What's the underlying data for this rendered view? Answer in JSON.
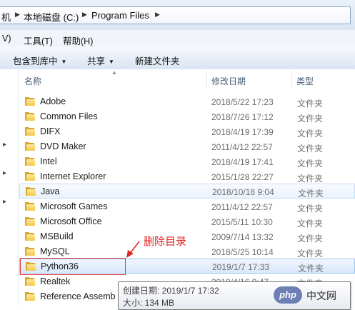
{
  "breadcrumb": {
    "partial": "机",
    "drive": "本地磁盘 (C:)",
    "folder": "Program Files"
  },
  "menu": {
    "view_partial": "V)",
    "tools": "工具(T)",
    "help": "帮助(H)"
  },
  "commands": {
    "include": "包含到库中",
    "share": "共享",
    "new_folder": "新建文件夹"
  },
  "columns": {
    "name": "名称",
    "modified": "修改日期",
    "type": "类型"
  },
  "files": [
    {
      "name": "Adobe",
      "date": "2018/5/22 17:23",
      "type": "文件夹"
    },
    {
      "name": "Common Files",
      "date": "2018/7/26 17:12",
      "type": "文件夹"
    },
    {
      "name": "DIFX",
      "date": "2018/4/19 17:39",
      "type": "文件夹"
    },
    {
      "name": "DVD Maker",
      "date": "2011/4/12 22:57",
      "type": "文件夹"
    },
    {
      "name": "Intel",
      "date": "2018/4/19 17:41",
      "type": "文件夹"
    },
    {
      "name": "Internet Explorer",
      "date": "2015/1/28 22:27",
      "type": "文件夹"
    },
    {
      "name": "Java",
      "date": "2018/10/18 9:04",
      "type": "文件夹"
    },
    {
      "name": "Microsoft Games",
      "date": "2011/4/12 22:57",
      "type": "文件夹"
    },
    {
      "name": "Microsoft Office",
      "date": "2015/5/11 10:30",
      "type": "文件夹"
    },
    {
      "name": "MSBuild",
      "date": "2009/7/14 13:32",
      "type": "文件夹"
    },
    {
      "name": "MySQL",
      "date": "2018/5/25 10:14",
      "type": "文件夹"
    },
    {
      "name": "Python36",
      "date": "2019/1/7 17:33",
      "type": "文件夹"
    },
    {
      "name": "Realtek",
      "date": "2018/4/16 9:47",
      "type": "文件夹"
    },
    {
      "name": "Reference Assemb",
      "date": "",
      "type": "文件夹"
    }
  ],
  "annotation": "删除目录",
  "tooltip": {
    "created": "创建日期: 2019/1/7 17:32",
    "size": "大小: 134 MB"
  },
  "watermark": {
    "badge": "php",
    "site": "中文网"
  },
  "colors": {
    "annotation_red": "#e02525",
    "selection_border": "#9cc3ee",
    "folder_yellow": "#f3c84b"
  }
}
